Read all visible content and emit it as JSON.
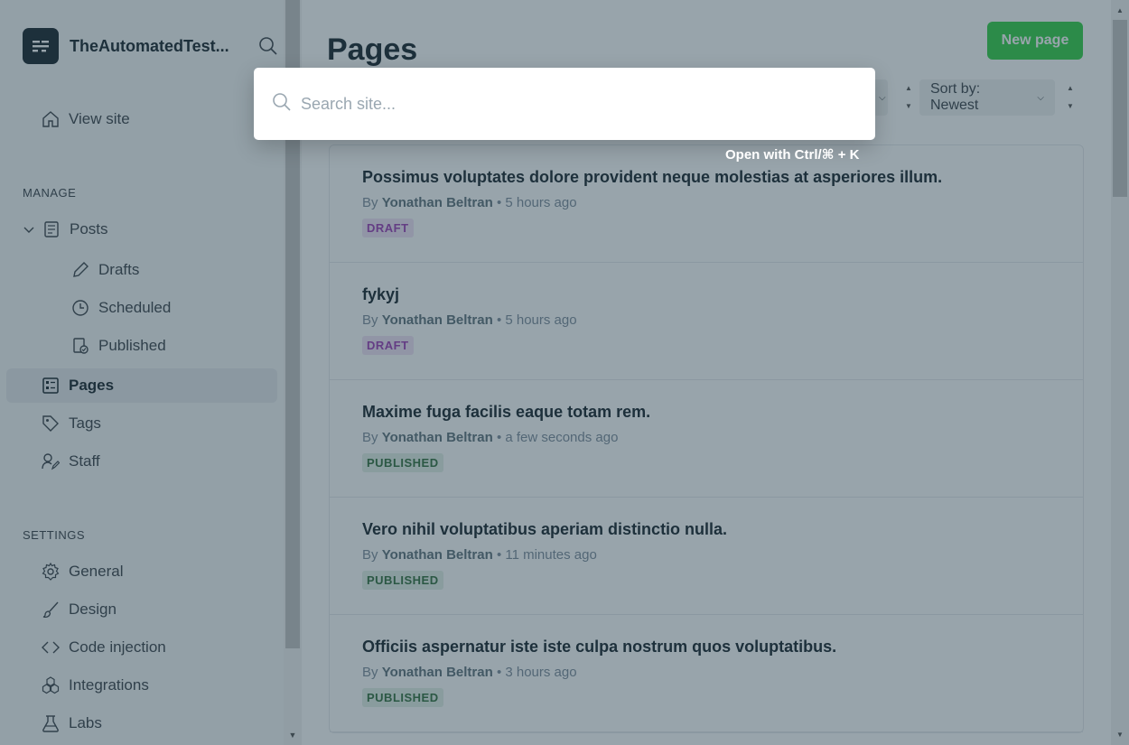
{
  "sidebar": {
    "brand_name": "TheAutomatedTest...",
    "view_site": "View site",
    "manage_label": "MANAGE",
    "posts": "Posts",
    "drafts": "Drafts",
    "scheduled": "Scheduled",
    "published": "Published",
    "pages": "Pages",
    "tags": "Tags",
    "staff": "Staff",
    "settings_label": "SETTINGS",
    "general": "General",
    "design": "Design",
    "code_injection": "Code injection",
    "integrations": "Integrations",
    "labs": "Labs"
  },
  "main": {
    "title": "Pages",
    "new_button": "New page",
    "sort_label": "Sort by: Newest",
    "rows": [
      {
        "title": "Possimus voluptates dolore provident neque molestias at asperiores illum.",
        "by": "By",
        "author": "Yonathan Beltran",
        "time": "• 5 hours ago",
        "status": "DRAFT"
      },
      {
        "title": "fykyj",
        "by": "By",
        "author": "Yonathan Beltran",
        "time": "• 5 hours ago",
        "status": "DRAFT"
      },
      {
        "title": "Maxime fuga facilis eaque totam rem.",
        "by": "By",
        "author": "Yonathan Beltran",
        "time": "• a few seconds ago",
        "status": "PUBLISHED"
      },
      {
        "title": "Vero nihil voluptatibus aperiam distinctio nulla.",
        "by": "By",
        "author": "Yonathan Beltran",
        "time": "• 11 minutes ago",
        "status": "PUBLISHED"
      },
      {
        "title": "Officiis aspernatur iste iste culpa nostrum quos voluptatibus.",
        "by": "By",
        "author": "Yonathan Beltran",
        "time": "• 3 hours ago",
        "status": "PUBLISHED"
      }
    ]
  },
  "search": {
    "placeholder": "Search site...",
    "shortcut_hint": "Open with Ctrl/⌘ + K"
  },
  "colors": {
    "accent": "#30cf43",
    "draft": "#9c3bb5",
    "published": "#2f6d3b"
  }
}
